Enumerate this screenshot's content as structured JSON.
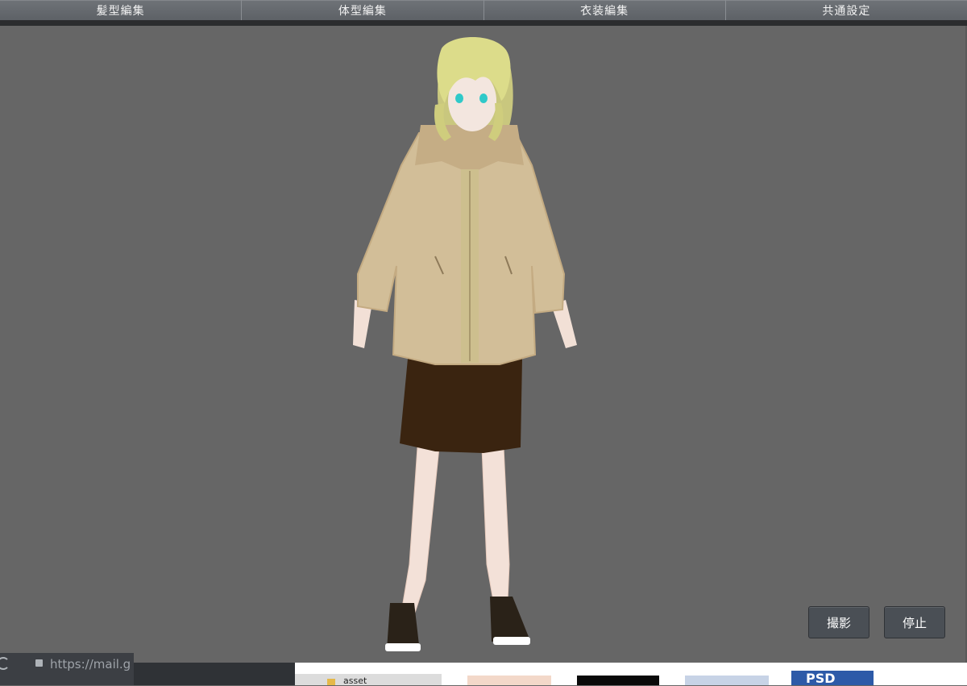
{
  "tabs": [
    {
      "label": "髪型編集"
    },
    {
      "label": "体型編集"
    },
    {
      "label": "衣装編集"
    },
    {
      "label": "共通設定"
    }
  ],
  "buttons": {
    "capture_label": "撮影",
    "stop_label": "停止"
  },
  "background": {
    "address_text": "https://mail.g",
    "folder_label": "asset",
    "psd_label": "PSD"
  },
  "colors": {
    "viewport_bg": "#666666",
    "tab_bg": "#6a6e73",
    "button_bg": "#4a4f55",
    "hair": "#d8d88a",
    "hoodie": "#d2be98",
    "skirt": "#3a2410",
    "skin": "#f2e0d6"
  }
}
